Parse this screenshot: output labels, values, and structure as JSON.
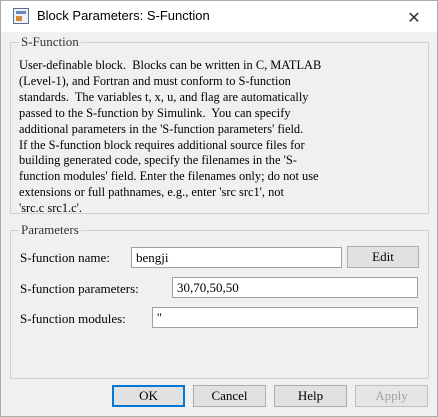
{
  "window": {
    "title": "Block Parameters: S-Function",
    "icon": "simulink-block-icon",
    "close_icon": "close-icon",
    "close_glyph": "✕"
  },
  "sfunction_group": {
    "label": "S-Function",
    "description": "User-definable block.  Blocks can be written in C, MATLAB\n(Level-1), and Fortran and must conform to S-function\nstandards.  The variables t, x, u, and flag are automatically\npassed to the S-function by Simulink.  You can specify\nadditional parameters in the 'S-function parameters' field.\nIf the S-function block requires additional source files for\nbuilding generated code, specify the filenames in the 'S-\nfunction modules' field. Enter the filenames only; do not use\nextensions or full pathnames, e.g., enter 'src src1', not\n'src.c src1.c'."
  },
  "parameters_group": {
    "label": "Parameters",
    "name_label": "S-function name:",
    "name_value": "bengji",
    "edit_label": "Edit",
    "params_label": "S-function parameters:",
    "params_value": "30,70,50,50",
    "modules_label": "S-function modules:",
    "modules_value": "''"
  },
  "buttons": {
    "ok": "OK",
    "cancel": "Cancel",
    "help": "Help",
    "apply": "Apply"
  }
}
